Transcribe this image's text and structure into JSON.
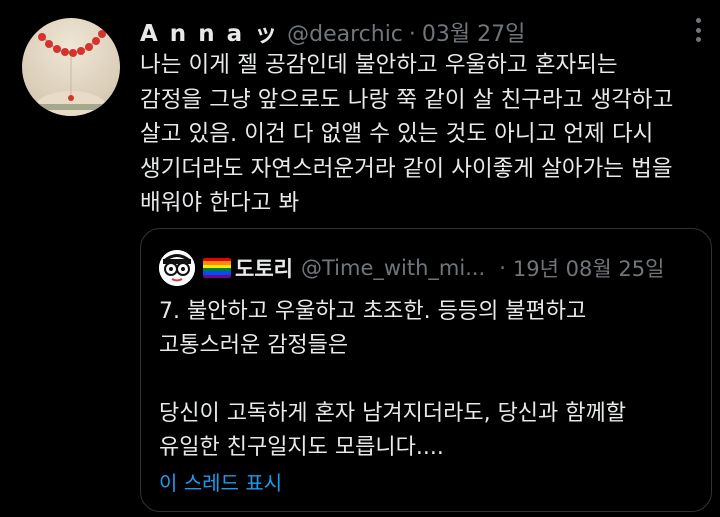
{
  "tweet": {
    "author_name": "A n n a ッ",
    "handle": "@dearchic",
    "separator": "·",
    "date": "03월 27일",
    "text": "나는 이게 젤 공감인데 불안하고 우울하고 혼자되는\n감정을 그냥 앞으로도 나랑 쭉 같이 살 친구라고 생각하고\n살고 있음. 이건 다 없앨 수 있는 것도 아니고 언제 다시\n생기더라도 자연스러운거라 같이 사이좋게 살아가는 법을\n배워야 한다고 봐"
  },
  "quoted": {
    "author_name": "도토리",
    "handle": "@Time_with_mi...",
    "separator": "·",
    "date": "19년 08월 25일",
    "text": "7. 불안하고 우울하고 초조한. 등등의 불편하고\n고통스러운 감정들은\n\n당신이 고독하게 혼자 남겨지더라도, 당신과 함께할\n유일한 친구일지도 모릅니다....",
    "show_thread": "이 스레드 표시",
    "flag_colors": [
      "#e40303",
      "#ff8c00",
      "#ffed00",
      "#008026",
      "#004dff",
      "#750787"
    ]
  },
  "colors": {
    "background": "#000000",
    "text": "#e7e9ea",
    "muted": "#71767b",
    "link": "#1d9bf0",
    "border": "#2f3336"
  },
  "icons": {
    "more": "more-horizontal-icon",
    "flag": "rainbow-flag-icon"
  }
}
